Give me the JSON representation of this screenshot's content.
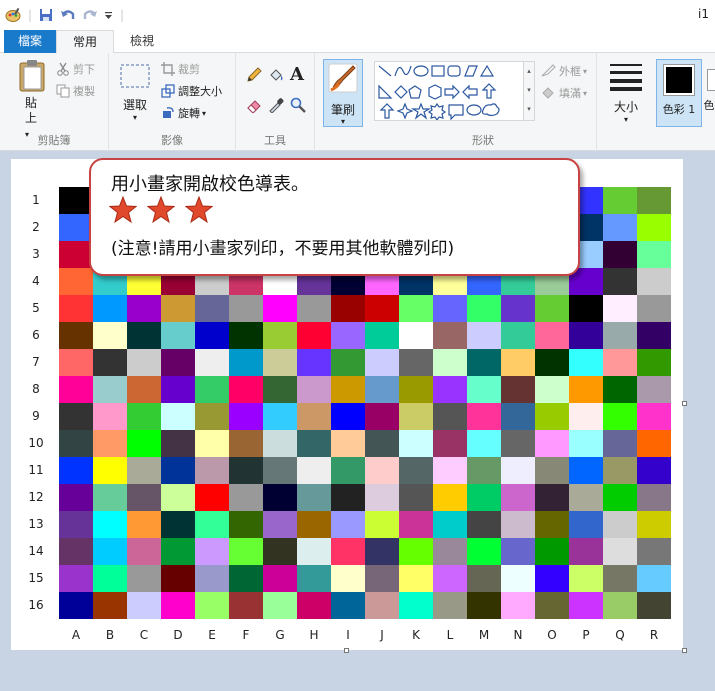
{
  "titlebar": {
    "title_fragment": "i1"
  },
  "tabs": [
    {
      "label": "檔案"
    },
    {
      "label": "常用"
    },
    {
      "label": "檢視"
    }
  ],
  "ribbon": {
    "clipboard": {
      "label": "剪貼簿",
      "paste": "貼上",
      "cut": "剪下",
      "copy": "複製"
    },
    "image": {
      "label": "影像",
      "select": "選取",
      "crop": "裁剪",
      "resize": "調整大小",
      "rotate": "旋轉"
    },
    "tools": {
      "label": "工具"
    },
    "brush": {
      "label": "筆刷"
    },
    "shapes": {
      "label": "形狀",
      "outline": "外框",
      "fill": "填滿"
    },
    "size": {
      "label": "大小"
    },
    "colors": {
      "color1": "色彩 1",
      "color2_fragment": "色"
    }
  },
  "callout": {
    "line1": "用小畫家開啟校色導表。",
    "line2": "(注意!請用小畫家列印，不要用其他軟體列印)",
    "star_count": 3,
    "star_color": "#e0492b",
    "border_color": "#c84343"
  },
  "chart": {
    "row_labels": [
      "1",
      "2",
      "3",
      "4",
      "5",
      "6",
      "7",
      "8",
      "9",
      "10",
      "11",
      "12",
      "13",
      "14",
      "15",
      "16"
    ],
    "col_labels": [
      "A",
      "B",
      "C",
      "D",
      "E",
      "F",
      "G",
      "H",
      "I",
      "J",
      "K",
      "L",
      "M",
      "N",
      "O",
      "P",
      "Q",
      "R"
    ],
    "swatches": [
      [
        "#000000",
        "#333333",
        "#666666",
        "#999999",
        "#cccccc",
        "#ffffff",
        "#ff0000",
        "#00ff00",
        "#0000ff",
        "#ffff00",
        "#00ffff",
        "#ff00ff",
        "#333399",
        "#669933",
        "#99cc99",
        "#3333ff",
        "#66cc33",
        "#669933"
      ],
      [
        "#3366ff",
        "#6699ff",
        "#ff6633",
        "#33cc66",
        "#cc3399",
        "#9966cc",
        "#ffcc33",
        "#33ccff",
        "#cc6633",
        "#66cccc",
        "#cc3333",
        "#3399cc",
        "#99cc33",
        "#336699",
        "#cc9966",
        "#003366",
        "#6699ff",
        "#99ff00"
      ],
      [
        "#cc0033",
        "#ff9900",
        "#33cc33",
        "#9933ff",
        "#ffcccc",
        "#006633",
        "#993300",
        "#ccccff",
        "#00cc99",
        "#ff6699",
        "#666633",
        "#33ffcc",
        "#cc99ff",
        "#0099cc",
        "#996633",
        "#99ccff",
        "#330033",
        "#66ff99"
      ],
      [
        "#ff6633",
        "#33cccc",
        "#ffff33",
        "#990033",
        "#cccccc",
        "#cc3366",
        "#ffffff",
        "#663399",
        "#000033",
        "#ff66ff",
        "#003366",
        "#ffff99",
        "#3366ff",
        "#33cc99",
        "#99cc99",
        "#6600cc",
        "#333333",
        "#cccccc"
      ],
      [
        "#ff3333",
        "#0099ff",
        "#9900cc",
        "#cc9933",
        "#666699",
        "#999999",
        "#ff00ff",
        "#999999",
        "#990000",
        "#cc0000",
        "#66ff66",
        "#6666ff",
        "#33ff66",
        "#6633cc",
        "#66cc33",
        "#000000",
        "#ffeeff",
        "#999999"
      ],
      [
        "#663300",
        "#ffffcc",
        "#003333",
        "#66cccc",
        "#0000cc",
        "#003300",
        "#99cc33",
        "#ff0033",
        "#9966ff",
        "#00cc99",
        "#ffffff",
        "#996666",
        "#ccccff",
        "#33cc99",
        "#ff6699",
        "#330099",
        "#99aaaa",
        "#330066"
      ],
      [
        "#ff6666",
        "#333333",
        "#cccccc",
        "#660066",
        "#eeeeee",
        "#0099cc",
        "#cccc99",
        "#6633ff",
        "#339933",
        "#ccccff",
        "#666666",
        "#ccffcc",
        "#006666",
        "#ffcc66",
        "#003300",
        "#33ffff",
        "#ff9999",
        "#339900"
      ],
      [
        "#ff0099",
        "#99cccc",
        "#cc6633",
        "#6600cc",
        "#33cc66",
        "#ff0066",
        "#336633",
        "#cc99cc",
        "#cc9900",
        "#6699cc",
        "#999900",
        "#9933ff",
        "#66ffcc",
        "#663333",
        "#ccffcc",
        "#ff9900",
        "#006600",
        "#aa99aa"
      ],
      [
        "#333333",
        "#ff99cc",
        "#33cc33",
        "#ccffff",
        "#999933",
        "#9900ff",
        "#33ccff",
        "#cc9966",
        "#0000ff",
        "#990066",
        "#cccc66",
        "#555555",
        "#ff3399",
        "#336699",
        "#99cc00",
        "#ffeeee",
        "#33ff00",
        "#ff33cc"
      ],
      [
        "#334444",
        "#ff9966",
        "#00ff00",
        "#443344",
        "#ffffaa",
        "#996633",
        "#ccdddd",
        "#336666",
        "#ffcc99",
        "#445555",
        "#ccffff",
        "#993366",
        "#66ffff",
        "#666666",
        "#ff99ff",
        "#99ffff",
        "#666699",
        "#ff6600"
      ],
      [
        "#0033ff",
        "#ffff00",
        "#aaaa99",
        "#003399",
        "#bb99aa",
        "#223333",
        "#667777",
        "#eeeeee",
        "#339966",
        "#ffcccc",
        "#556666",
        "#ffccff",
        "#669966",
        "#eeeeff",
        "#888877",
        "#0066ff",
        "#999966",
        "#3300cc"
      ],
      [
        "#660099",
        "#66cc99",
        "#665566",
        "#ccff99",
        "#ff0000",
        "#999999",
        "#000033",
        "#669999",
        "#222222",
        "#ddccdd",
        "#555555",
        "#ffcc00",
        "#00cc66",
        "#cc66cc",
        "#332233",
        "#aaaa99",
        "#00cc00",
        "#887788"
      ],
      [
        "#663399",
        "#00ffff",
        "#ff9933",
        "#003333",
        "#33ff99",
        "#336600",
        "#9966cc",
        "#996600",
        "#9999ff",
        "#ccff33",
        "#cc3399",
        "#00cccc",
        "#444444",
        "#ccbbcc",
        "#666600",
        "#3366cc",
        "#cccccc",
        "#cccc00"
      ],
      [
        "#663366",
        "#00ccff",
        "#cc6699",
        "#009933",
        "#cc99ff",
        "#66ff33",
        "#333322",
        "#ddeeee",
        "#ff3366",
        "#333366",
        "#66ff00",
        "#998899",
        "#00ff33",
        "#6666cc",
        "#009900",
        "#993399",
        "#dddddd",
        "#777777"
      ],
      [
        "#9933cc",
        "#00ff99",
        "#999999",
        "#660000",
        "#9999cc",
        "#006633",
        "#cc0099",
        "#339999",
        "#ffffcc",
        "#776677",
        "#ffff66",
        "#cc66ff",
        "#666655",
        "#eeffff",
        "#3300ff",
        "#ccff66",
        "#777766",
        "#66ccff"
      ],
      [
        "#000099",
        "#993300",
        "#ccccff",
        "#ff00cc",
        "#99ff66",
        "#993333",
        "#99ff99",
        "#cc0066",
        "#006699",
        "#cc9999",
        "#00ffcc",
        "#999988",
        "#333300",
        "#ffaaff",
        "#666633",
        "#cc33ff",
        "#99cc66",
        "#444433"
      ]
    ]
  }
}
